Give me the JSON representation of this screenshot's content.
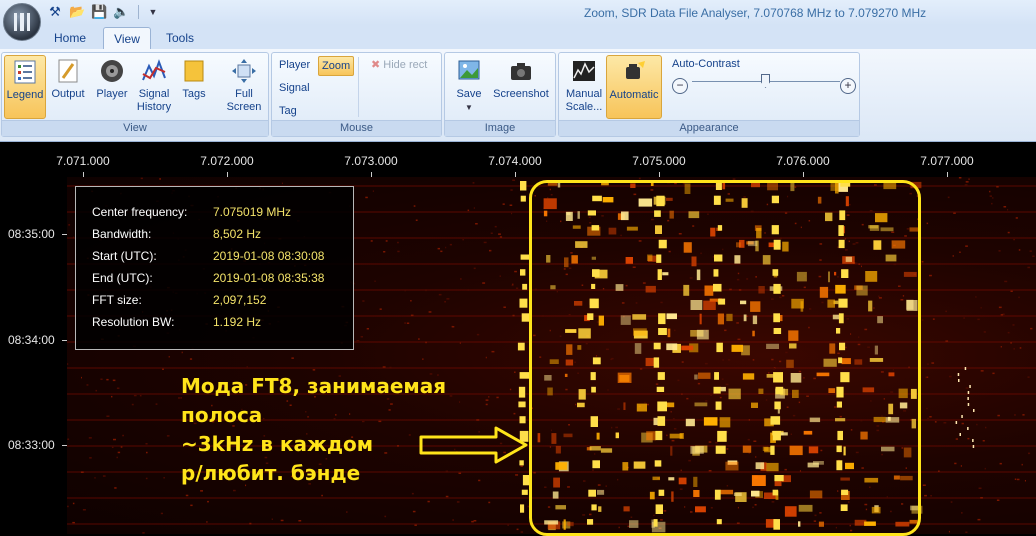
{
  "window": {
    "title": "Zoom,  SDR Data File Analyser, 7.070768 MHz to 7.079270 MHz",
    "qat_icons": [
      "tools-icon",
      "open-folder-icon",
      "save-icon",
      "volume-icon"
    ]
  },
  "tabs": [
    {
      "label": "Home",
      "selected": false
    },
    {
      "label": "View",
      "selected": true
    },
    {
      "label": "Tools",
      "selected": false
    }
  ],
  "ribbon": {
    "view_group": {
      "label": "View",
      "buttons": [
        {
          "label": "Legend",
          "active": true
        },
        {
          "label": "Output",
          "active": false
        },
        {
          "label": "Player",
          "active": false
        },
        {
          "label": "Signal History",
          "active": false
        },
        {
          "label": "Tags",
          "active": false
        },
        {
          "label": "Full Screen",
          "active": false
        }
      ]
    },
    "mouse_group": {
      "label": "Mouse",
      "player": "Player",
      "zoom": "Zoom",
      "hide_rect": "Hide rect",
      "signal": "Signal",
      "tag": "Tag"
    },
    "image_group": {
      "label": "Image",
      "save": "Save",
      "screenshot": "Screenshot"
    },
    "appearance_group": {
      "label": "Appearance",
      "manual_scale": "Manual Scale...",
      "automatic": "Automatic",
      "auto_contrast": "Auto-Contrast",
      "contrast_level": 0.48
    }
  },
  "axes": {
    "frequency_ticks": [
      "7.071.000",
      "7.072.000",
      "7.073.000",
      "7.074.000",
      "7.075.000",
      "7.076.000",
      "7.077.000"
    ],
    "time_ticks": [
      "08:35:00",
      "08:34:00",
      "08:33:00"
    ]
  },
  "legend": {
    "rows": [
      {
        "key": "Center frequency:",
        "value": "7.075019 MHz"
      },
      {
        "key": "Bandwidth:",
        "value": "8,502 Hz"
      },
      {
        "key": "Start (UTC):",
        "value": "2019-01-08 08:30:08"
      },
      {
        "key": "End (UTC):",
        "value": "2019-01-08 08:35:38"
      },
      {
        "key": "FFT size:",
        "value": "2,097,152"
      },
      {
        "key": "Resolution BW:",
        "value": "1.192 Hz"
      }
    ]
  },
  "annotation": {
    "lines": [
      "Мода FT8, занимаемая",
      "полоса",
      "~3kHz в каждом",
      "р/любит. бэнде"
    ]
  },
  "colors": {
    "accent_yellow": "#ffe41a",
    "legend_value": "#f4e36a",
    "ribbon_text": "#15428b",
    "active_button": "#f7c45a"
  }
}
